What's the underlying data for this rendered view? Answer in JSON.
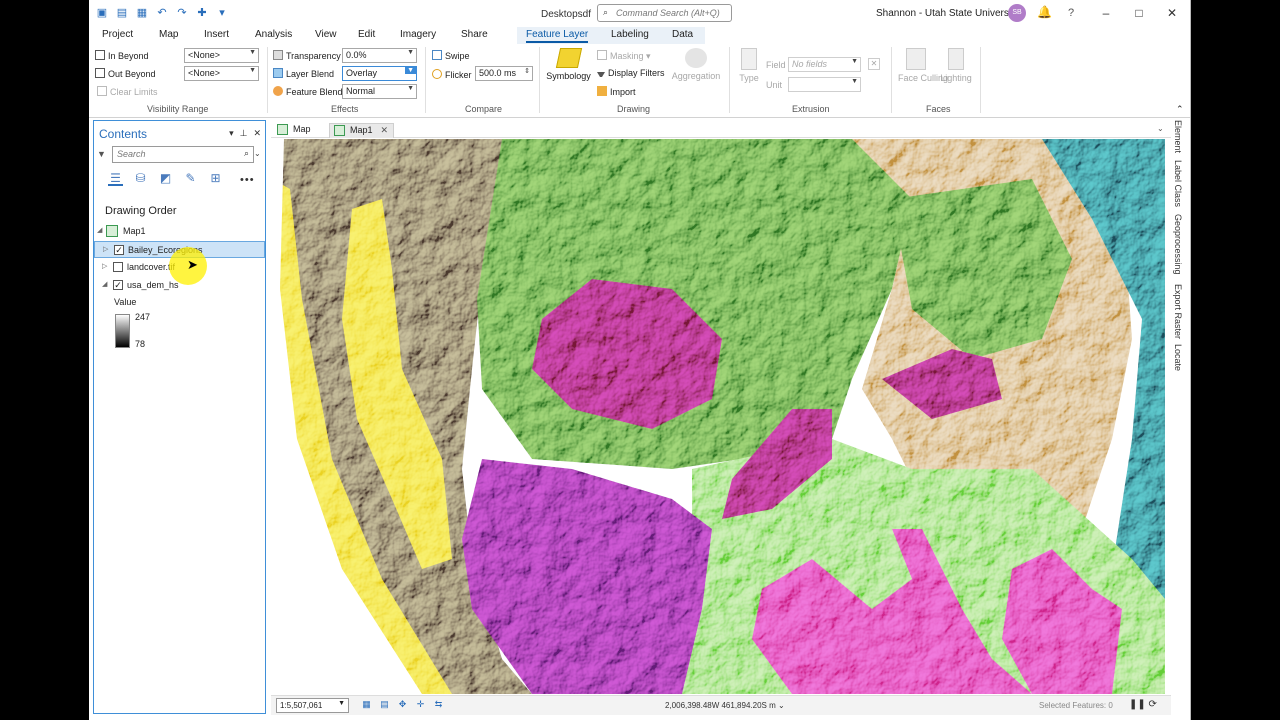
{
  "window": {
    "app_title": "Desktopsdf",
    "command_search_placeholder": "Command Search (Alt+Q)",
    "user": "Shannon - Utah State University",
    "avatar_initials": "SB",
    "help": "?",
    "minimize": "–",
    "maximize": "□",
    "close": "✕"
  },
  "ribbon_tabs": [
    {
      "label": "Project"
    },
    {
      "label": "Map"
    },
    {
      "label": "Insert"
    },
    {
      "label": "Analysis"
    },
    {
      "label": "View"
    },
    {
      "label": "Edit"
    },
    {
      "label": "Imagery"
    },
    {
      "label": "Share"
    },
    {
      "label": "Feature Layer",
      "active": true
    },
    {
      "label": "Labeling"
    },
    {
      "label": "Data"
    }
  ],
  "ribbon": {
    "visibility_range": {
      "in_beyond_label": "In Beyond",
      "in_beyond_value": "<None>",
      "out_beyond_label": "Out Beyond",
      "out_beyond_value": "<None>",
      "clear_limits": "Clear Limits",
      "group": "Visibility Range"
    },
    "effects": {
      "transparency_label": "Transparency",
      "transparency_value": "0.0%",
      "layer_blend_label": "Layer Blend",
      "layer_blend_value": "Overlay",
      "feature_blend_label": "Feature Blend",
      "feature_blend_value": "Normal",
      "group": "Effects"
    },
    "compare": {
      "swipe": "Swipe",
      "flicker_label": "Flicker",
      "flicker_value": "500.0",
      "flicker_unit": "ms",
      "group": "Compare"
    },
    "drawing": {
      "symbology": "Symbology",
      "masking": "Masking",
      "display_filters": "Display Filters",
      "import": "Import",
      "aggregation": "Aggregation",
      "group": "Drawing"
    },
    "extrusion": {
      "type": "Type",
      "field_label": "Field",
      "field_value": "No fields",
      "unit_label": "Unit",
      "group": "Extrusion"
    },
    "faces": {
      "face_culling": "Face Culling",
      "lighting": "Lighting",
      "group": "Faces"
    }
  },
  "contents": {
    "title": "Contents",
    "search_placeholder": "Search",
    "drawing_order": "Drawing Order",
    "map_name": "Map1",
    "layers": [
      {
        "name": "Bailey_Ecoregions",
        "checked": true,
        "selected": true
      },
      {
        "name": "landcover.tif",
        "checked": false,
        "selected": false
      },
      {
        "name": "usa_dem_hs",
        "checked": true,
        "selected": false
      }
    ],
    "legend": {
      "title": "Value",
      "high": "247",
      "low": "78"
    }
  },
  "view_tabs": [
    {
      "label": "Map",
      "active": false
    },
    {
      "label": "Map1",
      "active": true
    }
  ],
  "status": {
    "scale": "1:5,507,061",
    "coordinates": "2,006,398.48W 461,894.20S m",
    "selected_features": "Selected Features: 0"
  },
  "right_dock": [
    "Element",
    "Label Class",
    "Geoprocessing",
    "Export Raster",
    "Locate"
  ],
  "colors": {
    "accent": "#2a6ebb",
    "eco_green": "#6aa84f",
    "eco_lightgreen": "#9be07a",
    "eco_tan": "#e8c48a",
    "eco_teal": "#3d8c95",
    "eco_yellow": "#f2e24a",
    "eco_magenta": "#a8327a",
    "eco_purple": "#9b3aa8",
    "eco_pink": "#e04fb5"
  }
}
